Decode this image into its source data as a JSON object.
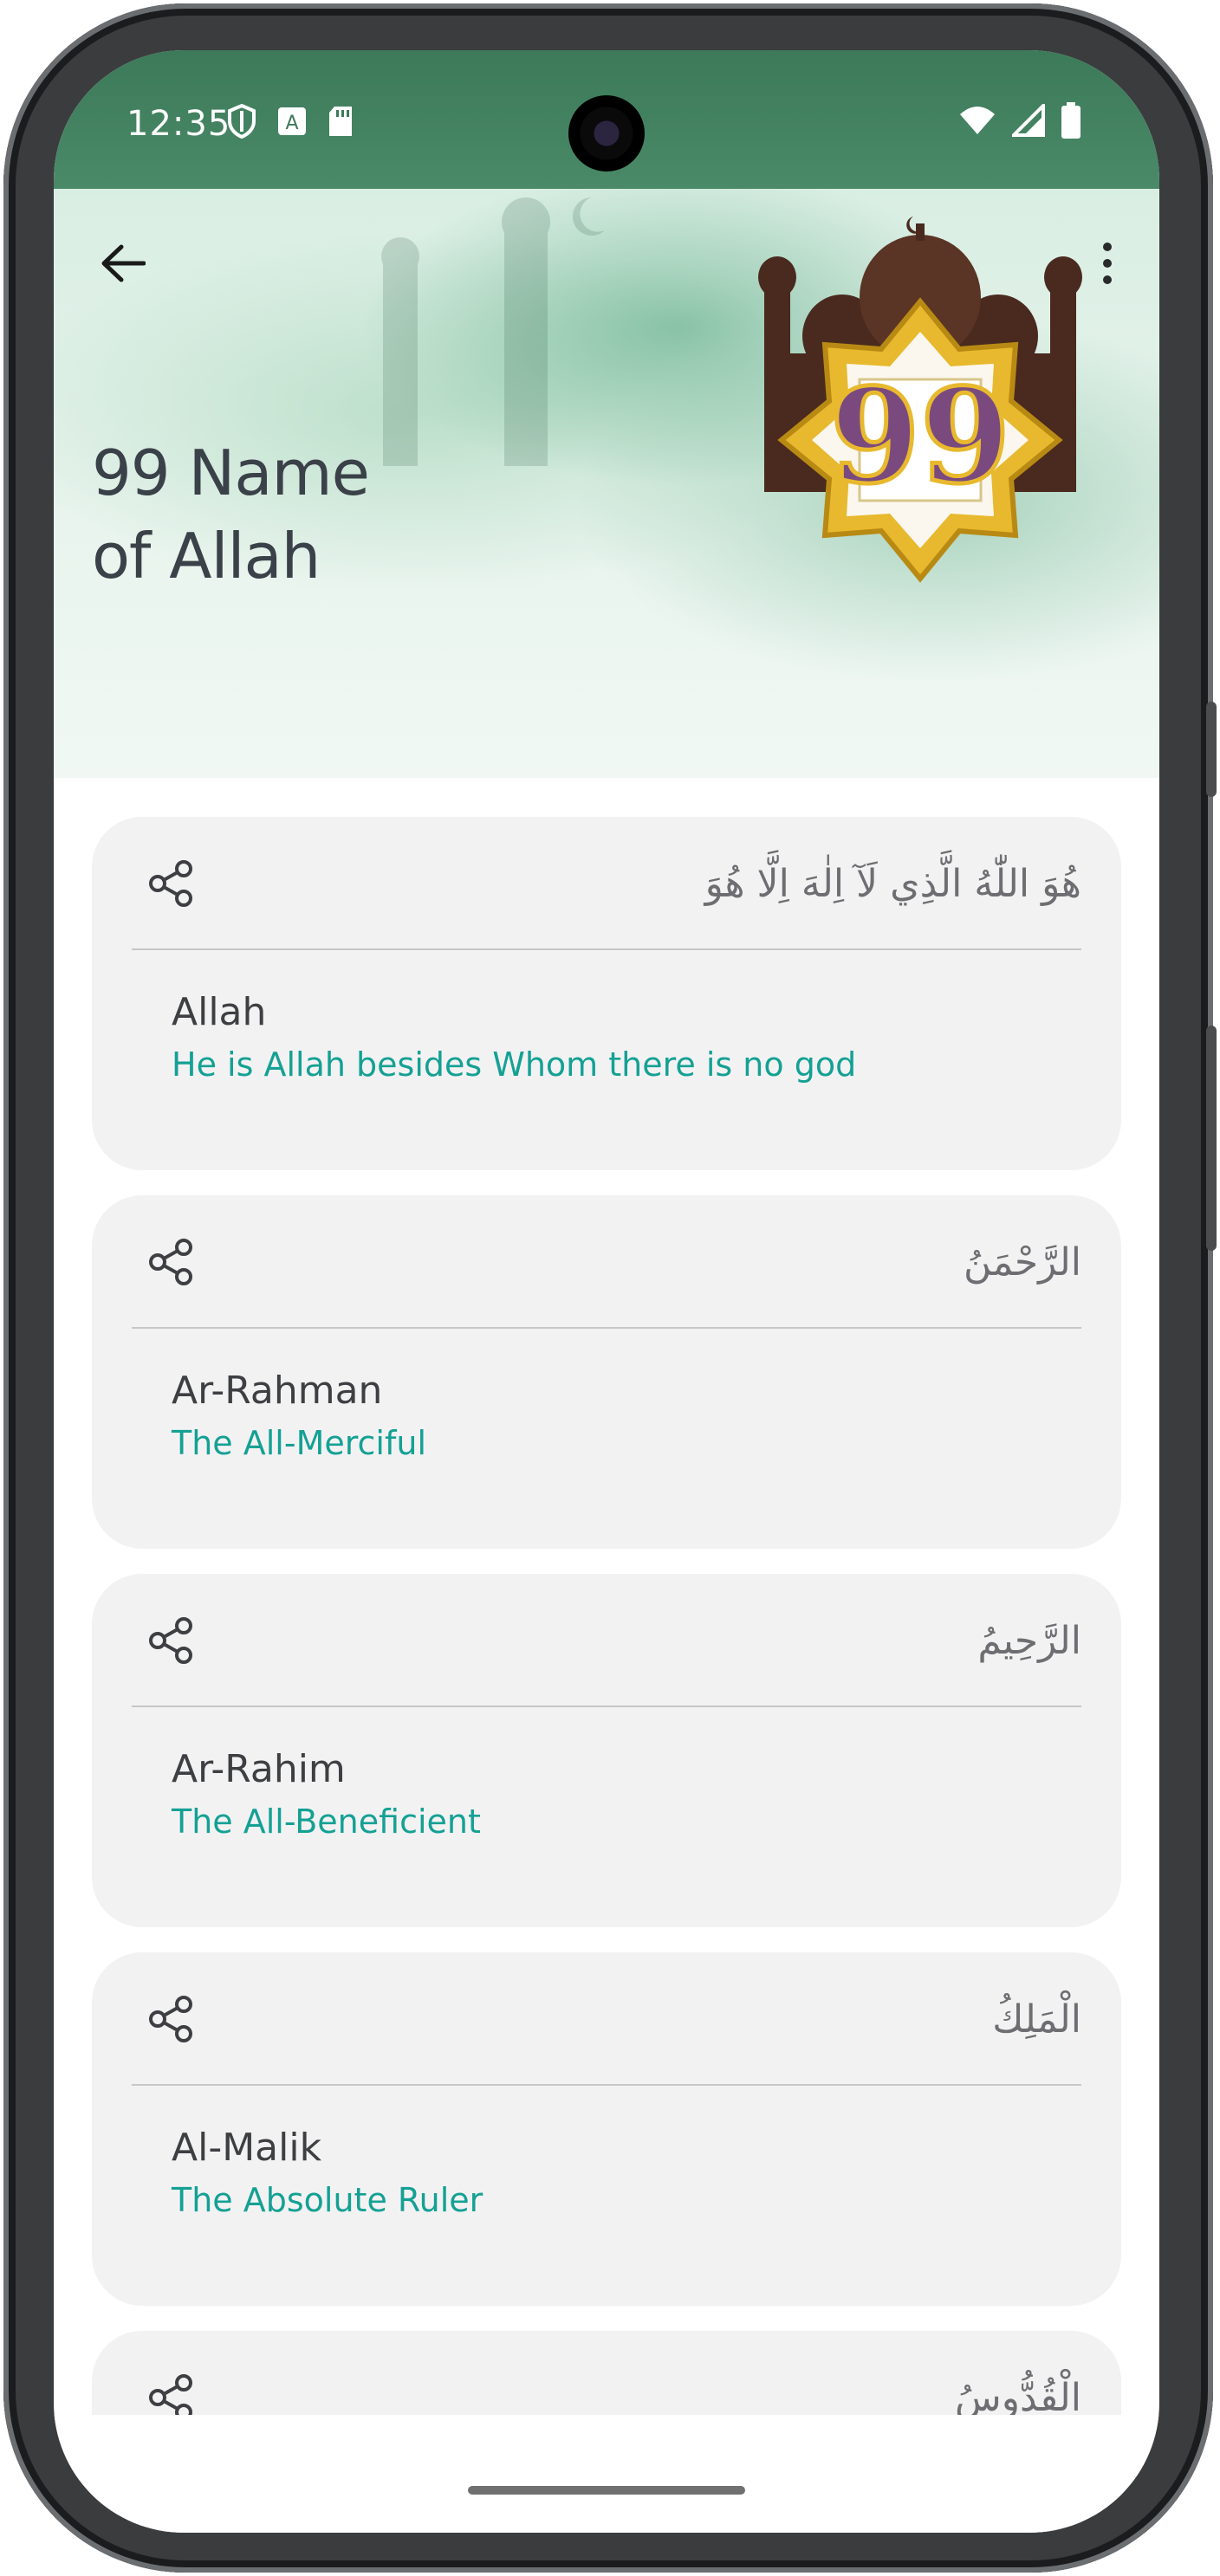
{
  "status_bar": {
    "time": "12:35",
    "left_icons": [
      "shield-icon",
      "translate-icon",
      "sd-card-icon"
    ],
    "right_icons": [
      "wifi-icon",
      "signal-icon",
      "battery-icon"
    ]
  },
  "header": {
    "title": "99 Name\nof Allah",
    "emblem_text": "99"
  },
  "names": [
    {
      "arabic": "هُوَ اللّٰهُ الَّذِي لَآ اِلٰهَ اِلَّا هُوَ",
      "transliteration": "Allah",
      "meaning": "He is Allah besides Whom there is no god"
    },
    {
      "arabic": "الرَّحْمَنُ",
      "transliteration": "Ar-Rahman",
      "meaning": "The All-Merciful"
    },
    {
      "arabic": "الرَّحِيمُ",
      "transliteration": "Ar-Rahim",
      "meaning": "The All-Beneficient"
    },
    {
      "arabic": "الْمَلِكُ",
      "transliteration": "Al-Malik",
      "meaning": "The Absolute Ruler"
    },
    {
      "arabic": "الْقُدُّوسُ",
      "transliteration": "",
      "meaning": ""
    }
  ],
  "colors": {
    "accent_teal": "#14a194",
    "header_green": "#3c7a5a",
    "card_background": "#f3f2f3"
  }
}
